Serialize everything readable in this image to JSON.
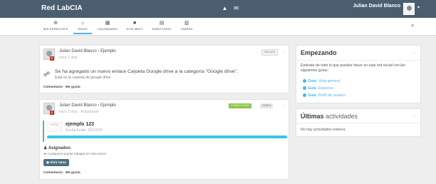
{
  "topbar": {
    "brand": "Red LabCIA",
    "icons": [
      "bell-icon",
      "envelope-icon"
    ],
    "user_name": "Julian David Blanco",
    "user_caret": "▾"
  },
  "nav": {
    "items": [
      {
        "icon": "⊕",
        "label": "Mis espacios ▾",
        "icon_name": "globe-icon"
      },
      {
        "icon": "⌂",
        "label": "Inicio",
        "icon_name": "home-icon"
      },
      {
        "icon": "▦",
        "label": "Calendario",
        "icon_name": "calendar-icon"
      },
      {
        "icon": "■",
        "label": "Jitsi Meet",
        "icon_name": "video-icon"
      },
      {
        "icon": "▤",
        "label": "Directorio",
        "icon_name": "directory-icon"
      },
      {
        "icon": "▥",
        "label": "Tareas",
        "icon_name": "tasks-icon"
      }
    ],
    "search_icon": "⌕"
  },
  "posts": [
    {
      "author": "Julian David Blanco",
      "separator": "›",
      "space": "Ejemplo",
      "time": "hace 2 días",
      "tag": "ENLACE",
      "message": "Se ha agregado un nuevo enlace Carpeta Google drive a la categoría \"Google drive\".",
      "sub": "Esta es la carpeta de google drive",
      "actions": "Comentario · Me gusta"
    },
    {
      "author": "Julian David Blanco",
      "separator": "›",
      "space": "Ejemplo",
      "time": "hace 2 días · Actualizado",
      "tag_done": "COMPLETADO",
      "tag_task": "TAREA",
      "task_day": "ENERO",
      "task_title": "ejemplo 123",
      "task_deadline": "Fecha límite: 10/12/20",
      "progress": 1.0,
      "assigned_label": "Asignados:",
      "assigned_text": "Cualquiera puede trabajar en esta tarea!",
      "open_button": "Abrir tarea",
      "actions": "Comentario · Me gusta"
    }
  ],
  "sidebar": {
    "getting_started": {
      "title": "Empezando",
      "text": "Entérate de todo lo que puedes hacer en esta red social con las siguientes guías:",
      "guides": [
        {
          "bold": "Guía:",
          "label": "Vista general"
        },
        {
          "bold": "Guía:",
          "label": "Espacios"
        },
        {
          "bold": "Guía:",
          "label": "Perfil de usuario"
        }
      ]
    },
    "activities": {
      "title_strong": "Últimas",
      "title_rest": "actividades",
      "empty": "No hay actividades todavía."
    }
  },
  "colors": {
    "topbar": "#4a5e70",
    "accent": "#4fb6e6",
    "done": "#8bc34a",
    "progress": "#38c6e1"
  }
}
